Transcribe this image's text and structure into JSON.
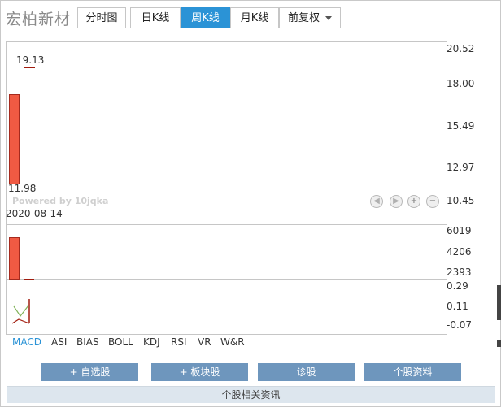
{
  "header": {
    "stock_name": "宏柏新材",
    "tabs": [
      {
        "label": "分时图",
        "active": false
      },
      {
        "label": "日K线",
        "active": false
      },
      {
        "label": "周K线",
        "active": true
      },
      {
        "label": "月K线",
        "active": false
      }
    ],
    "adjust_select": {
      "label": "前复权"
    }
  },
  "price_panel": {
    "y_labels": [
      "20.52",
      "18.00",
      "15.49",
      "12.97",
      "10.45"
    ],
    "high_label": "19.13",
    "low_label": "11.98",
    "watermark": "Powered by 10jqka",
    "date_label": "2020-08-14"
  },
  "volume_panel": {
    "y_labels": [
      "6019",
      "4206",
      "2393"
    ]
  },
  "macd_panel": {
    "y_labels": [
      "0.29",
      "0.11",
      "-0.07"
    ]
  },
  "controls": [
    "arrow-left",
    "arrow-right",
    "zoom-in",
    "zoom-out"
  ],
  "indicators": [
    {
      "label": "MACD",
      "active": true
    },
    {
      "label": "ASI",
      "active": false
    },
    {
      "label": "BIAS",
      "active": false
    },
    {
      "label": "BOLL",
      "active": false
    },
    {
      "label": "KDJ",
      "active": false
    },
    {
      "label": "RSI",
      "active": false
    },
    {
      "label": "VR",
      "active": false
    },
    {
      "label": "W&R",
      "active": false
    }
  ],
  "actions": {
    "add_watchlist": "+ 自选股",
    "add_sector": "+ 板块股",
    "diagnose": "诊股",
    "profile": "个股资料"
  },
  "footer": {
    "label": "个股相关资讯"
  },
  "colors": {
    "accent": "#2b93d6",
    "candle_up": "#f05a43",
    "button_bg": "#6e96bd"
  }
}
